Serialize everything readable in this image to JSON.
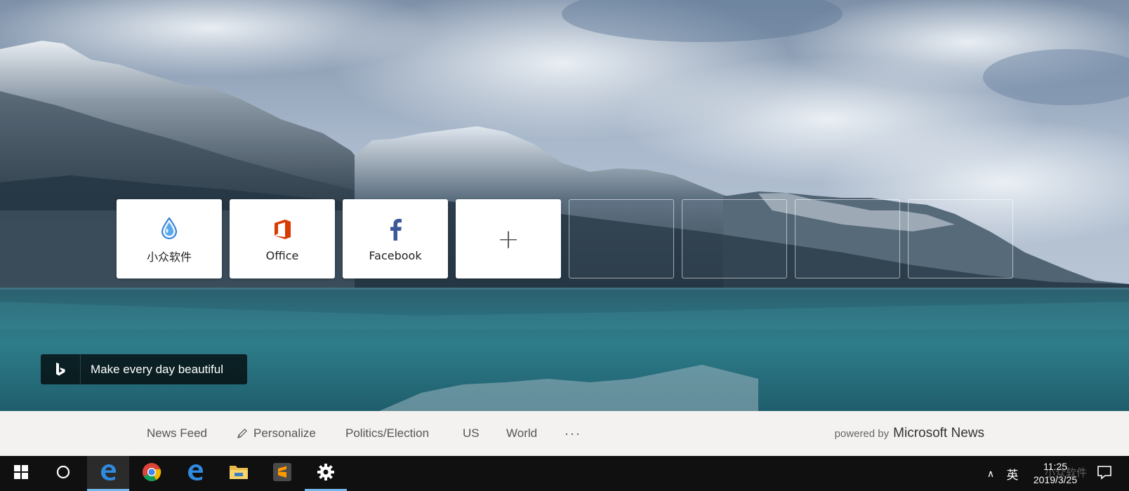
{
  "top_sites": [
    {
      "label": "小众软件",
      "icon": "water-drop-icon"
    },
    {
      "label": "Office",
      "icon": "office-icon"
    },
    {
      "label": "Facebook",
      "icon": "facebook-icon"
    }
  ],
  "add_site": {
    "icon": "plus-icon"
  },
  "caption": {
    "text": "Make every day beautiful",
    "icon": "bing-icon"
  },
  "news_nav": {
    "items": [
      "News Feed",
      "Personalize",
      "Politics/Election",
      "US",
      "World"
    ],
    "more": "···"
  },
  "powered": {
    "by": "powered by",
    "brand": "Microsoft News"
  },
  "taskbar": {
    "apps": [
      "start-icon",
      "cortana-icon",
      "edge-icon",
      "chrome-icon",
      "edge-icon",
      "file-explorer-icon",
      "sublime-text-icon",
      "settings-icon"
    ],
    "tray_chevron": "∧",
    "ime": "英",
    "time": "11:25",
    "date": "2019/3/25",
    "watermark": "小众软件"
  },
  "colors": {
    "accent": "#76b9ed",
    "office_orange": "#d83b01",
    "facebook_blue": "#3b5998",
    "taskbar": "#101010",
    "newsbar": "#f3f2f1"
  }
}
